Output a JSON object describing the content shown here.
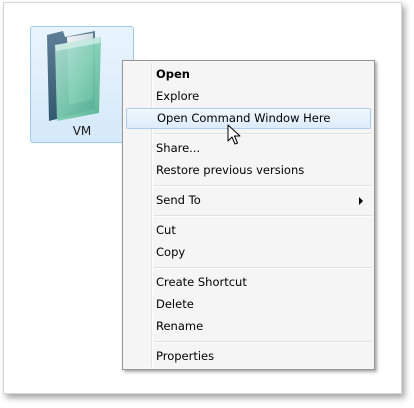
{
  "folder": {
    "label": "VM",
    "icon": "folder-icon"
  },
  "context_menu": {
    "items": [
      {
        "label": "Open",
        "bold": true
      },
      {
        "label": "Explore"
      },
      {
        "label": "Open Command Window Here",
        "highlighted": true
      },
      {
        "label": "Share..."
      },
      {
        "label": "Restore previous versions"
      },
      {
        "label": "Send To",
        "has_submenu": true
      },
      {
        "label": "Cut"
      },
      {
        "label": "Copy"
      },
      {
        "label": "Create Shortcut"
      },
      {
        "label": "Delete"
      },
      {
        "label": "Rename"
      },
      {
        "label": "Properties"
      }
    ]
  },
  "colors": {
    "highlight_border": "#aeccef",
    "folder_selection": "#d5e9f9",
    "menu_background": "#f5f5f5"
  },
  "pointer": "arrow-cursor-icon"
}
